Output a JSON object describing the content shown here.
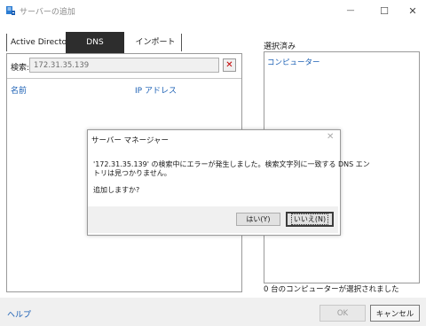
{
  "window": {
    "title": "サーバーの追加",
    "minimize_glyph": "—",
    "maximize_glyph": "☐",
    "close_glyph": "✕"
  },
  "tabs": [
    {
      "label": "Active Directory"
    },
    {
      "label": "DNS"
    },
    {
      "label": "インポート"
    }
  ],
  "search": {
    "label": "検索:",
    "value": "172.31.35.139",
    "clear_glyph": "✕"
  },
  "results": {
    "columns": [
      "名前",
      "IP アドレス"
    ]
  },
  "selected": {
    "label": "選択済み",
    "column": "コンピューター",
    "status": "0 台のコンピューターが選択されました"
  },
  "footer": {
    "help": "ヘルプ",
    "ok": "OK",
    "cancel": "キャンセル"
  },
  "dialog": {
    "title": "サーバー マネージャー",
    "close_glyph": "✕",
    "message_line1": "'172.31.35.139' の検索中にエラーが発生しました。検索文字列に一致する DNS エン",
    "message_line2": "トリは見つかりません。",
    "question": "追加しますか?",
    "yes": "はい(Y)",
    "no": "いいえ(N)"
  },
  "colors": {
    "accent_link": "#1a5fb4",
    "active_tab_bg": "#2d2d2d",
    "clear_button_x": "#c40000"
  }
}
